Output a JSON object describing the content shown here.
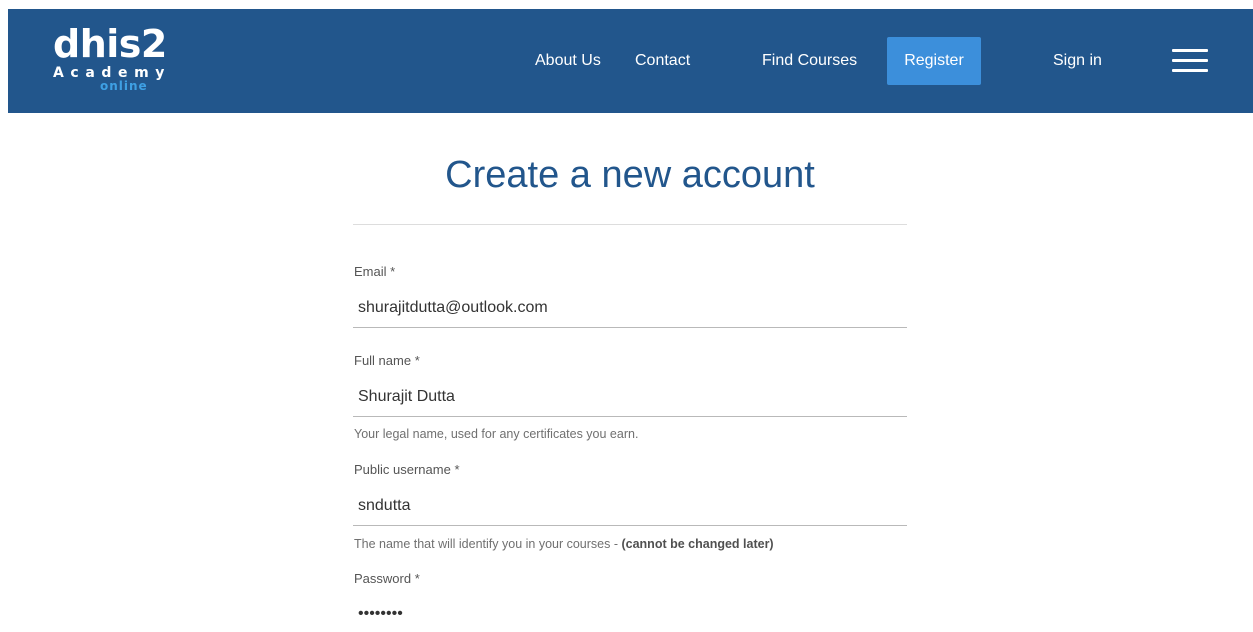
{
  "header": {
    "logo": {
      "main": "dhis2",
      "sub": "Academy",
      "tag": "online"
    },
    "nav": {
      "about": "About Us",
      "contact": "Contact",
      "find_courses": "Find Courses",
      "register": "Register",
      "sign_in": "Sign in"
    },
    "menu_icon": "hamburger-menu-icon",
    "colors": {
      "background": "#22568c",
      "register_button": "#3c8fdb",
      "logo_accent": "#3ea0e4"
    }
  },
  "form": {
    "title": "Create a new account",
    "email": {
      "label": "Email *",
      "value": "shurajitdutta@outlook.com"
    },
    "full_name": {
      "label": "Full name *",
      "value": "Shurajit Dutta",
      "help": "Your legal name, used for any certificates you earn."
    },
    "username": {
      "label": "Public username *",
      "value": "sndutta",
      "help": "The name that will identify you in your courses - ",
      "help_bold": "(cannot be changed later)"
    },
    "password": {
      "label": "Password *",
      "value": "password"
    }
  }
}
